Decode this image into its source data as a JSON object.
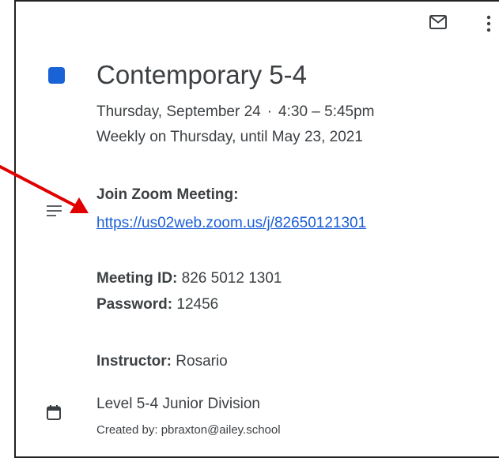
{
  "event": {
    "title": "Contemporary 5-4",
    "date": "Thursday, September 24",
    "separator": "·",
    "time": "4:30 – 5:45pm",
    "recurrence": "Weekly on Thursday, until May 23, 2021",
    "color": "#1a63d6"
  },
  "description": {
    "join_label": "Join Zoom Meeting:",
    "join_link": "https://us02web.zoom.us/j/82650121301",
    "meeting_id_label": "Meeting ID:",
    "meeting_id_value": "826 5012 1301",
    "password_label": "Password:",
    "password_value": "12456",
    "instructor_label": "Instructor:",
    "instructor_value": "Rosario"
  },
  "calendar": {
    "name": "Level 5-4 Junior Division",
    "created_by": "Created by: pbraxton@ailey.school"
  },
  "icons": {
    "email": "email-icon",
    "more": "more-vert-icon",
    "description": "notes-icon",
    "calendar": "calendar-icon",
    "annotation": "red-arrow-annotation"
  },
  "colors": {
    "link": "#1a5fd6",
    "annotation": "#e00000"
  }
}
